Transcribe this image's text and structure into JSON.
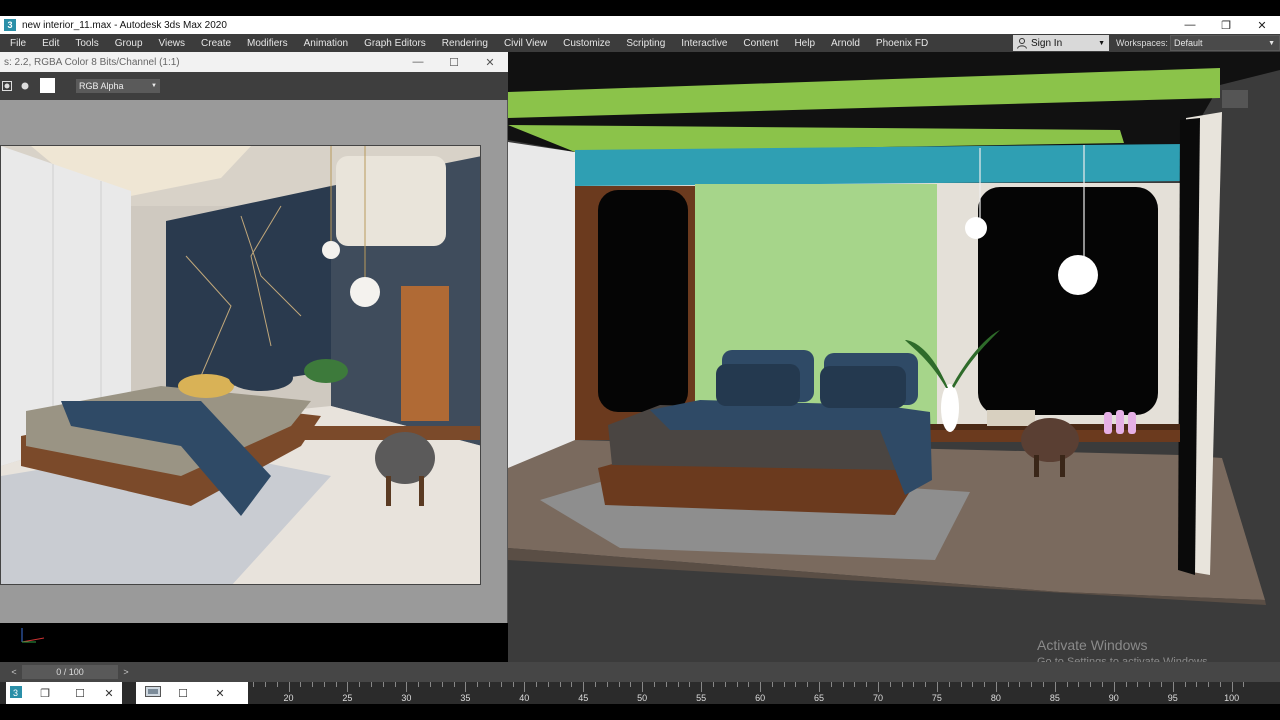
{
  "window": {
    "title": "new interior_11.max - Autodesk 3ds Max 2020",
    "app_icon": "3ds-max-icon",
    "app_icon_glyph": "3",
    "minimize": "—",
    "restore": "❐",
    "close": "✕"
  },
  "menubar": {
    "items": [
      "File",
      "Edit",
      "Tools",
      "Group",
      "Views",
      "Create",
      "Modifiers",
      "Animation",
      "Graph Editors",
      "Rendering",
      "Civil View",
      "Customize",
      "Scripting",
      "Interactive",
      "Content",
      "Help",
      "Arnold",
      "Phoenix FD"
    ],
    "sign_in": "Sign In",
    "workspaces_label": "Workspaces:",
    "workspace_value": "Default"
  },
  "render_window": {
    "title": "s: 2.2, RGBA Color 8 Bits/Channel (1:1)",
    "channel": "RGB Alpha",
    "minimize": "—",
    "maximize": "☐",
    "close": "✕"
  },
  "viewport": {
    "colors": {
      "background": "#3b3b3b",
      "floor": "#7a6a5e",
      "ceiling_green": "#8bc34a",
      "fascia_teal": "#2f9fb3",
      "accent_wall": "#a6d58a",
      "wood": "#6b3a1e",
      "window_black": "#050505",
      "pillow_blue": "#2f4a66"
    }
  },
  "watermark": {
    "line1": "Activate Windows",
    "line2": "Go to Settings to activate Windows."
  },
  "timeline": {
    "frame": "0 / 100",
    "prev": "<",
    "next": ">",
    "ruler_labels": [
      "20",
      "25",
      "30",
      "35",
      "40",
      "45",
      "50",
      "55",
      "60",
      "65",
      "70",
      "75",
      "80",
      "85",
      "90",
      "95",
      "100"
    ]
  },
  "taskbar": {
    "restore": "❐",
    "maximize": "☐",
    "close": "✕"
  }
}
